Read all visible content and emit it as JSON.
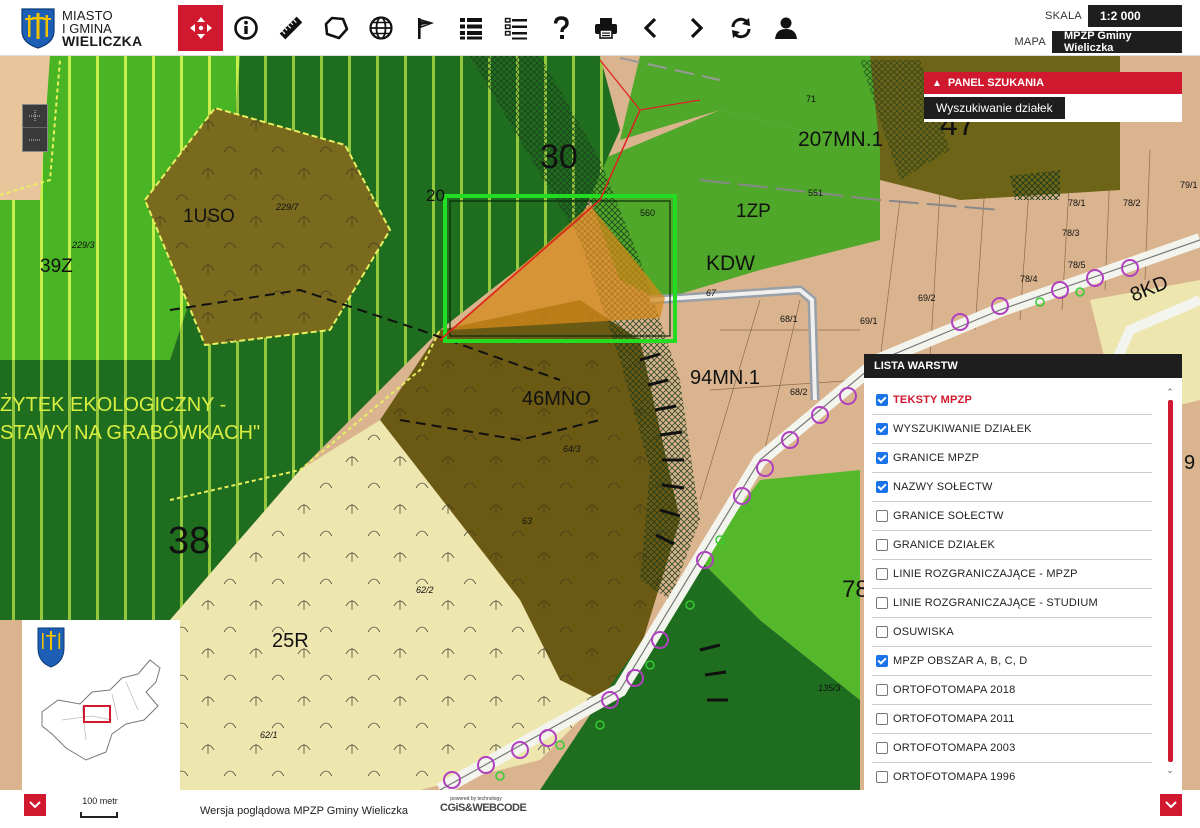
{
  "header": {
    "logo": {
      "line1": "MIASTO",
      "line2": "I GMINA",
      "line3": "WIELICZKA"
    },
    "tools": [
      {
        "name": "pan-tool",
        "icon": "move-arrows-icon",
        "active": true
      },
      {
        "name": "info-tool",
        "icon": "info-icon"
      },
      {
        "name": "measure-tool",
        "icon": "ruler-icon"
      },
      {
        "name": "polygon-tool",
        "icon": "polygon-icon"
      },
      {
        "name": "globe-tool",
        "icon": "globe-icon"
      },
      {
        "name": "flag-tool",
        "icon": "flag-icon"
      },
      {
        "name": "legend-tool",
        "icon": "list-icon"
      },
      {
        "name": "layers-list-tool",
        "icon": "list-outline-icon"
      },
      {
        "name": "help-tool",
        "icon": "question-icon"
      },
      {
        "name": "print-tool",
        "icon": "printer-icon"
      },
      {
        "name": "prev-view-tool",
        "icon": "chevron-left-icon"
      },
      {
        "name": "next-view-tool",
        "icon": "chevron-right-icon"
      },
      {
        "name": "refresh-tool",
        "icon": "refresh-icon"
      },
      {
        "name": "user-tool",
        "icon": "user-icon"
      }
    ],
    "scale_label": "SKALA",
    "scale_value": "1:2 000",
    "map_label": "MAPA",
    "map_value": "MPZP Gminy Wieliczka"
  },
  "search_panel": {
    "title": "PANEL SZUKANIA",
    "tab": "Wyszukiwanie działek"
  },
  "map_labels": {
    "uso": "1USO",
    "z39": "39Z",
    "zp1": "1ZP",
    "mn207": "207MN.1",
    "n47": "47",
    "n30": "30",
    "kdw": "KDW",
    "mn94": "94MN.1",
    "mno46": "46MNO",
    "n38": "38",
    "r25": "25R",
    "n78": "78",
    "eco1": "ŻYTEK EKOLOGICZNY -",
    "eco2": "STAWY NA GRABÓWKACH\"",
    "p71": "71",
    "p5510": "551",
    "p560": "560",
    "p2297": "229/7",
    "p2293": "229/3",
    "p67": "67",
    "p681": "68/1",
    "p691": "69/1",
    "p692": "69/2",
    "p682": "68/2",
    "p643": "64/3",
    "p63": "63",
    "p622": "62/2",
    "p621": "62/1",
    "p1353": "135/3",
    "p781": "78/1",
    "p782": "78/2",
    "p783": "78/3",
    "p784": "78/4",
    "p785": "78/5",
    "p791": "79/1",
    "kd8": "8KD",
    "p9": "9",
    "p20": "20"
  },
  "layers_panel": {
    "title": "LISTA WARSTW",
    "items": [
      {
        "label": "TEKSTY MPZP",
        "checked": true,
        "highlight": true
      },
      {
        "label": "WYSZUKIWANIE DZIAŁEK",
        "checked": true
      },
      {
        "label": "GRANICE MPZP",
        "checked": true
      },
      {
        "label": "NAZWY SOŁECTW",
        "checked": true
      },
      {
        "label": "GRANICE SOŁECTW",
        "checked": false
      },
      {
        "label": "GRANICE DZIAŁEK",
        "checked": false
      },
      {
        "label": "LINIE ROZGRANICZAJĄCE - MPZP",
        "checked": false
      },
      {
        "label": "LINIE ROZGRANICZAJĄCE - STUDIUM",
        "checked": false
      },
      {
        "label": "OSUWISKA",
        "checked": false
      },
      {
        "label": "MPZP OBSZAR A, B, C, D",
        "checked": true
      },
      {
        "label": "ORTOFOTOMAPA 2018",
        "checked": false
      },
      {
        "label": "ORTOFOTOMAPA 2011",
        "checked": false
      },
      {
        "label": "ORTOFOTOMAPA 2003",
        "checked": false
      },
      {
        "label": "ORTOFOTOMAPA 1996",
        "checked": false
      }
    ]
  },
  "footer": {
    "scale_text": "100 metr",
    "version_text": "Wersja poglądowa MPZP Gminy Wieliczka",
    "powered_small": "powered by technology",
    "powered_brand": "CGiS&WEBCODE"
  },
  "colors": {
    "accent": "#d0182f",
    "dark": "#1e1e1e",
    "forest_dark": "#1f6b1f",
    "green_light": "#55b82a",
    "olive": "#6b5a16",
    "tan": "#d4b08a",
    "cream": "#efe9b0",
    "highlight_green": "#22dd22"
  }
}
